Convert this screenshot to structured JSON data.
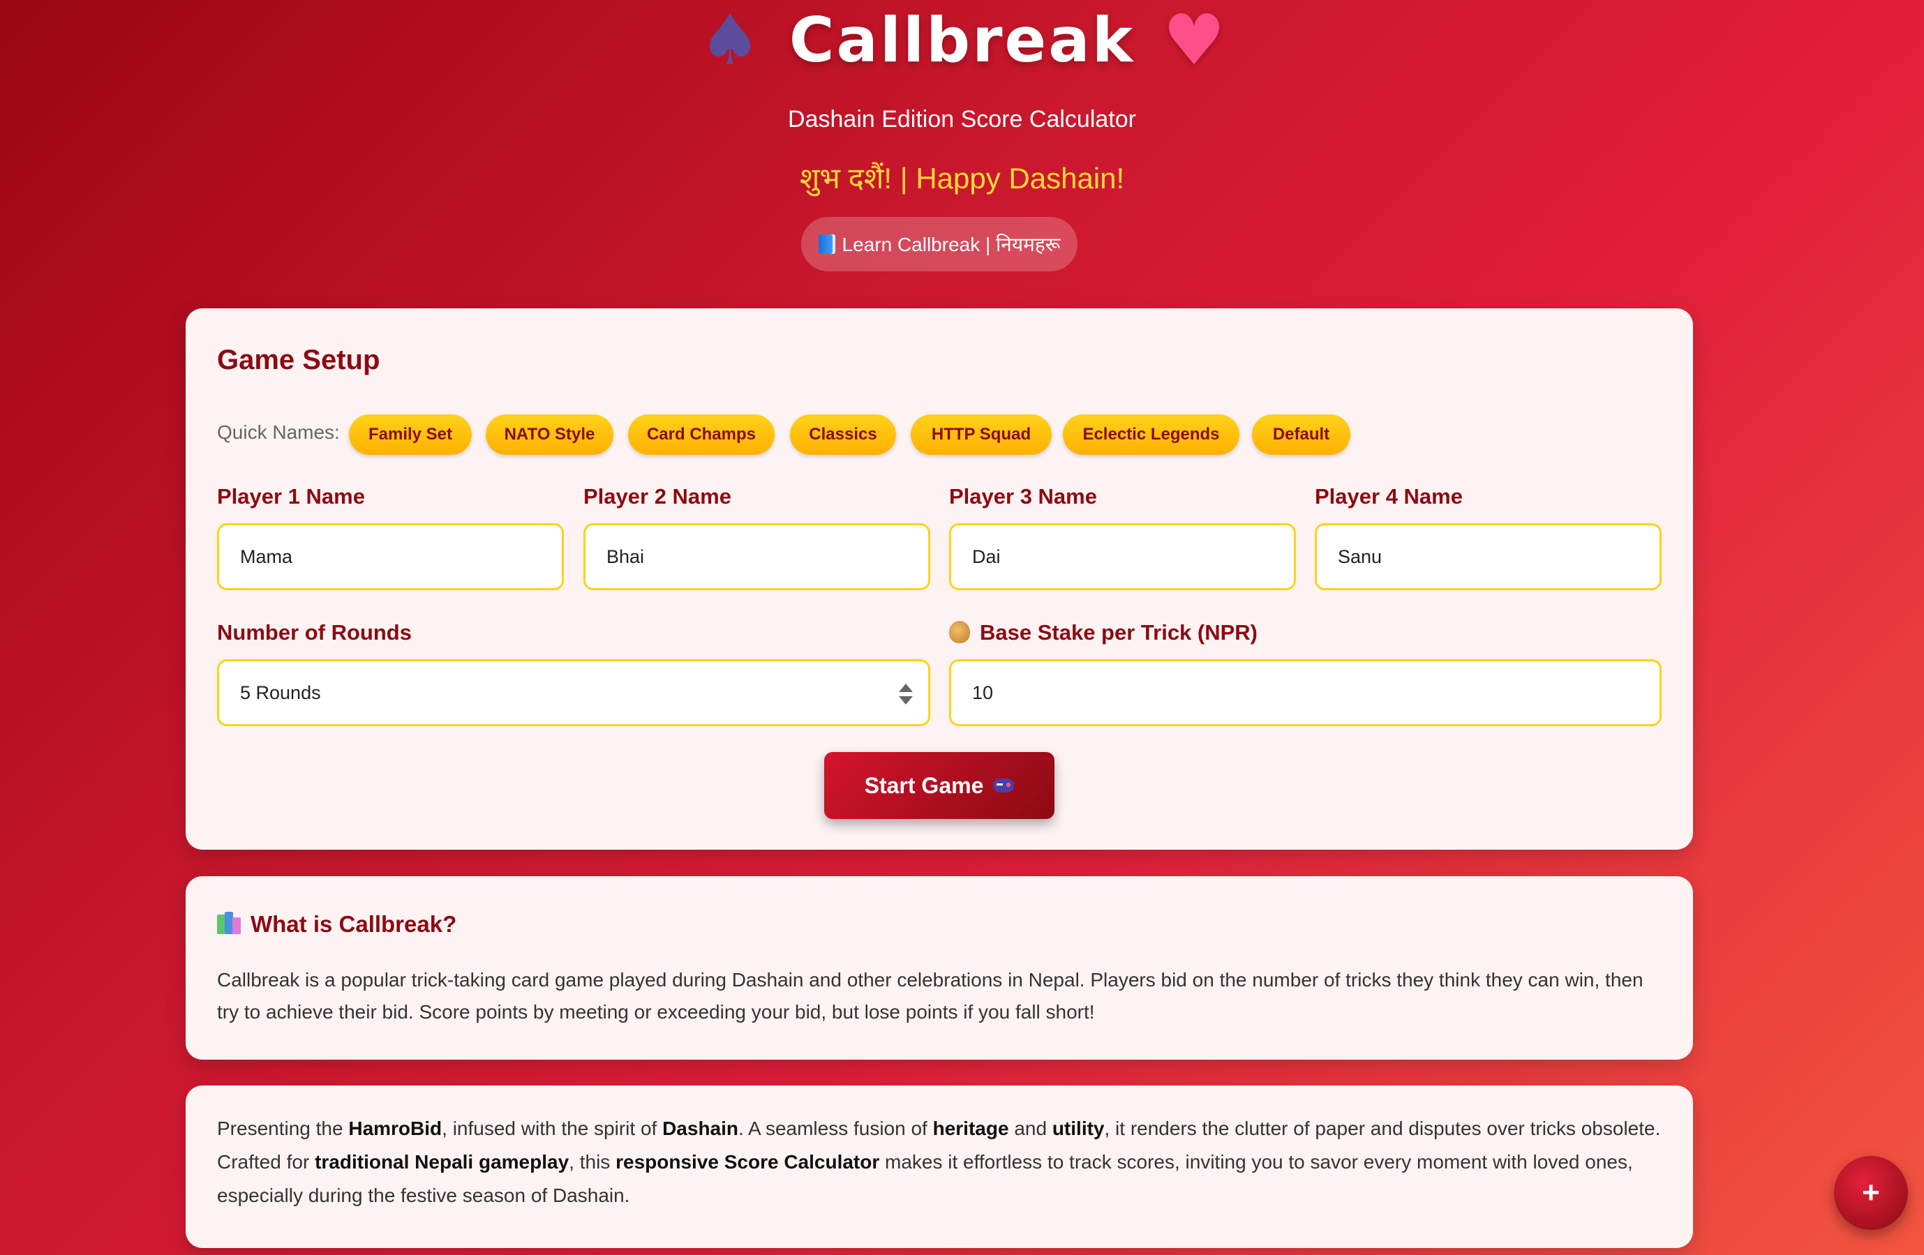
{
  "header": {
    "spade_icon": "♠",
    "title": "Callbreak",
    "heart_icon": "♥",
    "subtitle": "Dashain Edition Score Calculator",
    "greeting": "शुभ दशैं! | Happy Dashain!",
    "learn_button": "Learn Callbreak | नियमहरू"
  },
  "setup": {
    "title": "Game Setup",
    "quick_names_label": "Quick Names:",
    "quick_names": [
      "Family Set",
      "NATO Style",
      "Card Champs",
      "Classics",
      "HTTP Squad",
      "Eclectic Legends",
      "Default"
    ],
    "players": [
      {
        "label": "Player 1 Name",
        "value": "Mama"
      },
      {
        "label": "Player 2 Name",
        "value": "Bhai"
      },
      {
        "label": "Player 3 Name",
        "value": "Dai"
      },
      {
        "label": "Player 4 Name",
        "value": "Sanu"
      }
    ],
    "rounds_label": "Number of Rounds",
    "rounds_value": "5 Rounds",
    "stake_label": "Base Stake per Trick (NPR)",
    "stake_value": "10",
    "start_button": "Start Game"
  },
  "what": {
    "title": "What is Callbreak?",
    "text": "Callbreak is a popular trick-taking card game played during Dashain and other celebrations in Nepal. Players bid on the number of tricks they think they can win, then try to achieve their bid. Score points by meeting or exceeding your bid, but lose points if you fall short!"
  },
  "about": {
    "p1": "Presenting the ",
    "b1": "HamroBid",
    "p2": ", infused with the spirit of ",
    "b2": "Dashain",
    "p3": ". A seamless fusion of ",
    "b3": "heritage",
    "p4": " and ",
    "b4": "utility",
    "p5": ", it renders the clutter of paper and disputes over tricks obsolete. Crafted for ",
    "b5": "traditional Nepali gameplay",
    "p6": ", this ",
    "b6": "responsive Score Calculator",
    "p7": " makes it effortless to track scores, inviting you to savor every moment with loved ones, especially during the festive season of Dashain."
  },
  "fab": "+",
  "colors": {
    "accent": "#8b0a13",
    "chip": "#ffc10a",
    "greeting": "#ffd93b"
  }
}
